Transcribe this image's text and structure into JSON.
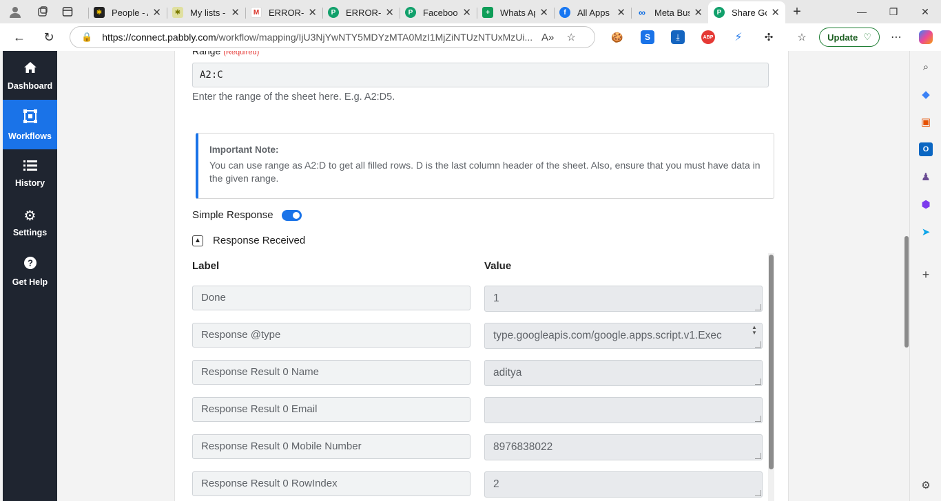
{
  "browser": {
    "tabs": [
      {
        "title": "People - A",
        "fav": "*",
        "color": "#f0c000"
      },
      {
        "title": "My lists -",
        "fav": "*",
        "color": "#b8b800"
      },
      {
        "title": "ERROR- p",
        "fav": "M",
        "color": "#d93025"
      },
      {
        "title": "ERROR- p",
        "fav": "P",
        "color": "#11a06b"
      },
      {
        "title": "Facebook",
        "fav": "P",
        "color": "#11a06b"
      },
      {
        "title": "Whats Ap",
        "fav": "+",
        "color": "#0f9d58"
      },
      {
        "title": "All Apps -",
        "fav": "f",
        "color": "#1877f2"
      },
      {
        "title": "Meta Busi",
        "fav": "∞",
        "color": "#0668e1"
      },
      {
        "title": "Share Goo",
        "fav": "P",
        "color": "#11a06b"
      }
    ],
    "url_domain": "https://connect.pabbly.com",
    "url_path": "/workflow/mapping/IjU3NjYwNTY5MDYzMTA0MzI1MjZiNTUzNTUxMzUi...",
    "update_label": "Update"
  },
  "nav": {
    "items": [
      {
        "label": "Dashboard"
      },
      {
        "label": "Workflows"
      },
      {
        "label": "History"
      },
      {
        "label": "Settings"
      },
      {
        "label": "Get Help"
      }
    ]
  },
  "form": {
    "range_label": "Range",
    "range_required": "(Required)",
    "range_value": "A2:C",
    "range_help": "Enter the range of the sheet here. E.g. A2:D5.",
    "note_title": "Important Note:",
    "note_body": "You can use range as A2:D to get all filled rows. D is the last column header of the sheet. Also, ensure that you must have data in the given range.",
    "simple_response_label": "Simple Response",
    "simple_response_on": true,
    "response_received_label": "Response Received",
    "col_label": "Label",
    "col_value": "Value",
    "rows": [
      {
        "label": "Done",
        "value": "1"
      },
      {
        "label": "Response @type",
        "value": "type.googleapis.com/google.apps.script.v1.Exec"
      },
      {
        "label": "Response Result 0 Name",
        "value": "aditya"
      },
      {
        "label": "Response Result 0 Email",
        "value": ""
      },
      {
        "label": "Response Result 0 Mobile Number",
        "value": "8976838022"
      },
      {
        "label": "Response Result 0 RowIndex",
        "value": "2"
      }
    ]
  }
}
